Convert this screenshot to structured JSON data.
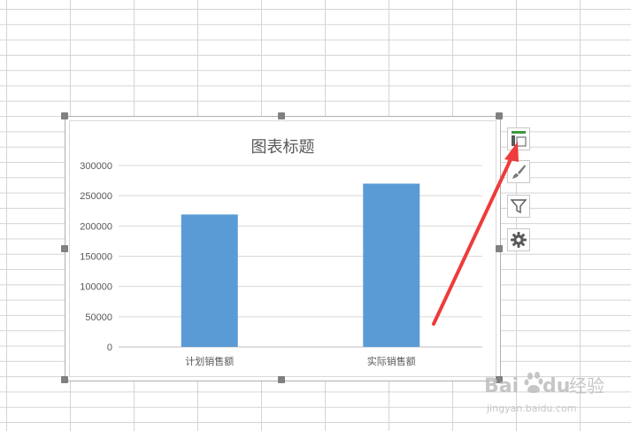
{
  "chart_data": {
    "type": "bar",
    "title": "图表标题",
    "categories": [
      "计划销售额",
      "实际销售额"
    ],
    "values": [
      219000,
      270000
    ],
    "ylim": [
      0,
      300000
    ],
    "yticks": [
      0,
      50000,
      100000,
      150000,
      200000,
      250000,
      300000
    ],
    "ytick_labels": [
      "0",
      "50000",
      "100000",
      "150000",
      "200000",
      "250000",
      "300000"
    ],
    "bar_color": "#5B9BD5",
    "grid": true,
    "legend": "none"
  },
  "side_buttons": {
    "elements": "chart-elements-icon",
    "styles": "paintbrush-icon",
    "filters": "funnel-icon",
    "settings": "gear-icon"
  },
  "annotation": {
    "arrow_color": "#EE3B3B"
  },
  "watermark": {
    "brand": "Baidu经验",
    "url": "jingyan.baidu.com"
  }
}
